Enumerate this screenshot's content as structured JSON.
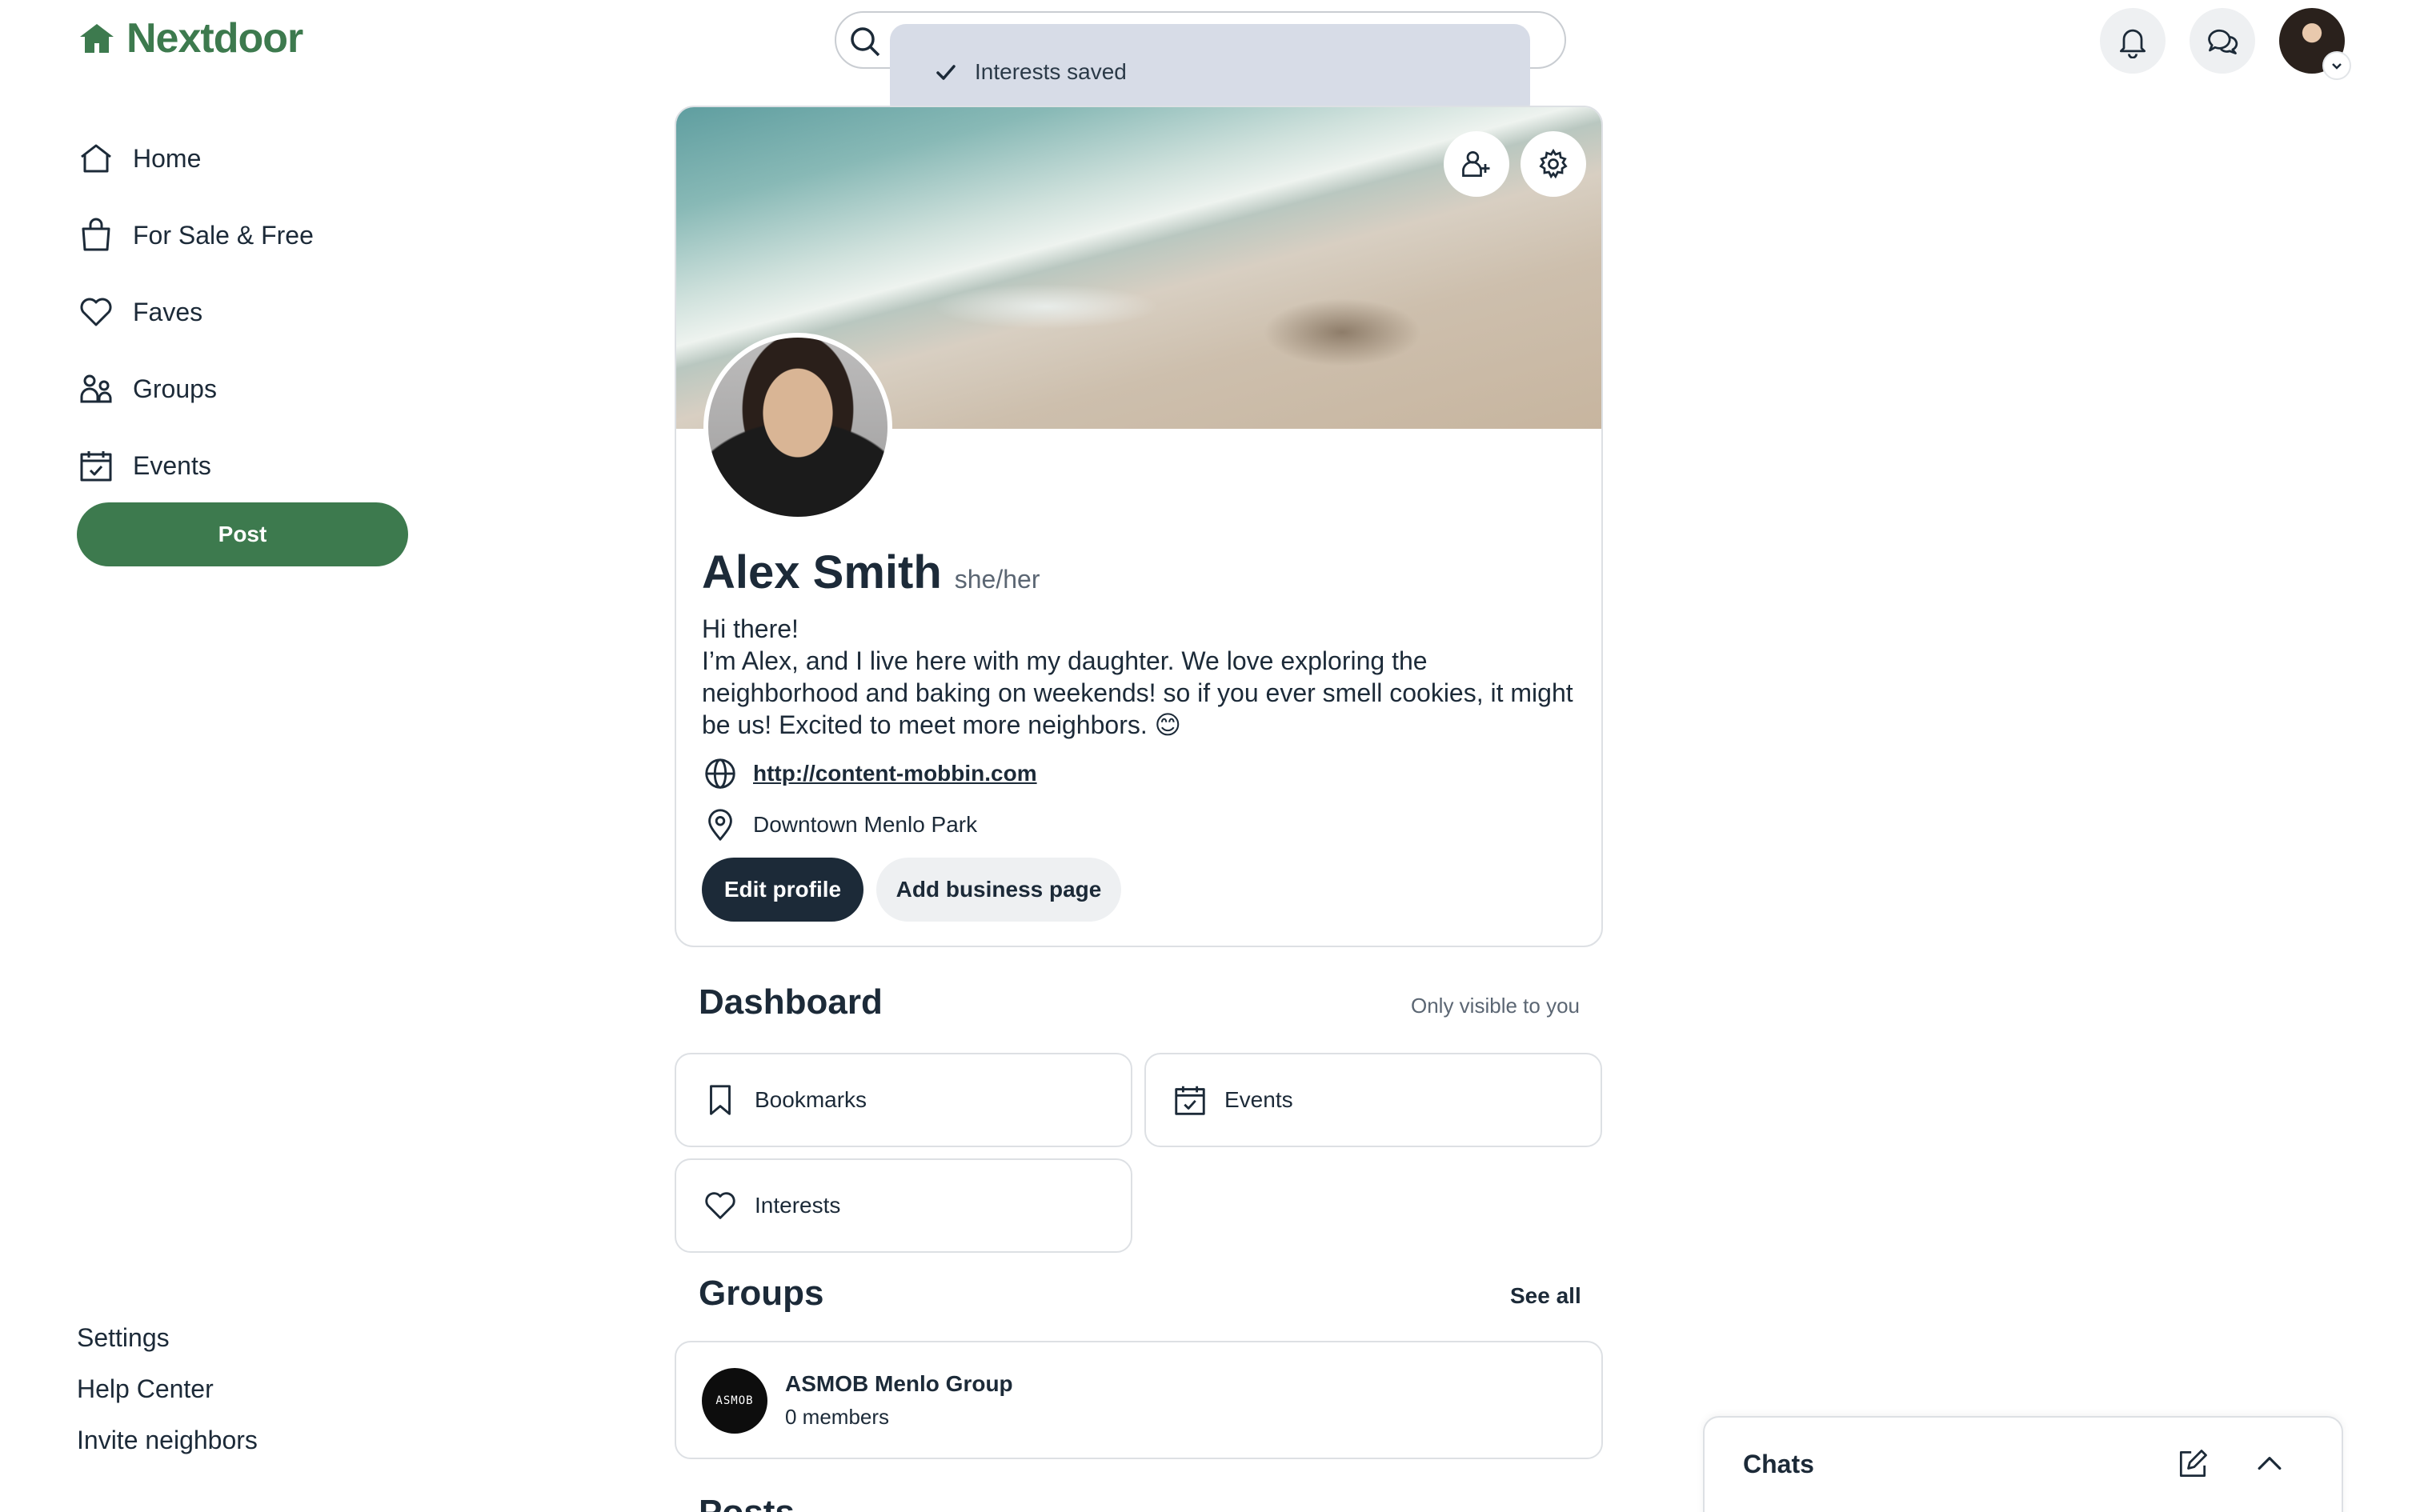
{
  "brand": {
    "name": "Nextdoor",
    "color": "#3d7a4e"
  },
  "sidebar": {
    "items": [
      {
        "label": "Home",
        "icon": "home-icon"
      },
      {
        "label": "For Sale & Free",
        "icon": "shopping-bag-icon"
      },
      {
        "label": "Faves",
        "icon": "heart-icon"
      },
      {
        "label": "Groups",
        "icon": "groups-icon"
      },
      {
        "label": "Events",
        "icon": "calendar-icon"
      }
    ],
    "post_label": "Post",
    "footer": [
      "Settings",
      "Help Center",
      "Invite neighbors"
    ]
  },
  "header": {
    "search_placeholder": "",
    "icons": [
      "bell-icon",
      "chat-bubbles-icon",
      "user-avatar"
    ]
  },
  "toast": {
    "text": "Interests saved",
    "icon": "check-icon"
  },
  "profile": {
    "name": "Alex Smith",
    "pronouns": "she/her",
    "bio_line1": "Hi there!",
    "bio_line2": "I’m Alex, and I live here with my daughter. We love exploring the neighborhood and baking on weekends! so if you ever smell cookies, it might be us! Excited to meet more neighbors. 😊",
    "website": "http://content-mobbin.com",
    "location": "Downtown Menlo Park",
    "edit_label": "Edit profile",
    "add_business_label": "Add business page"
  },
  "dashboard": {
    "title": "Dashboard",
    "visibility": "Only visible to you",
    "tiles": [
      {
        "label": "Bookmarks",
        "icon": "bookmark-icon"
      },
      {
        "label": "Events",
        "icon": "calendar-icon"
      },
      {
        "label": "Interests",
        "icon": "heart-icon"
      }
    ]
  },
  "groups": {
    "title": "Groups",
    "see_all": "See all",
    "items": [
      {
        "name": "ASMOB Menlo Group",
        "members": "0 members",
        "logo_text": "ASMOB"
      }
    ]
  },
  "posts": {
    "title": "Posts"
  },
  "chats": {
    "title": "Chats"
  }
}
